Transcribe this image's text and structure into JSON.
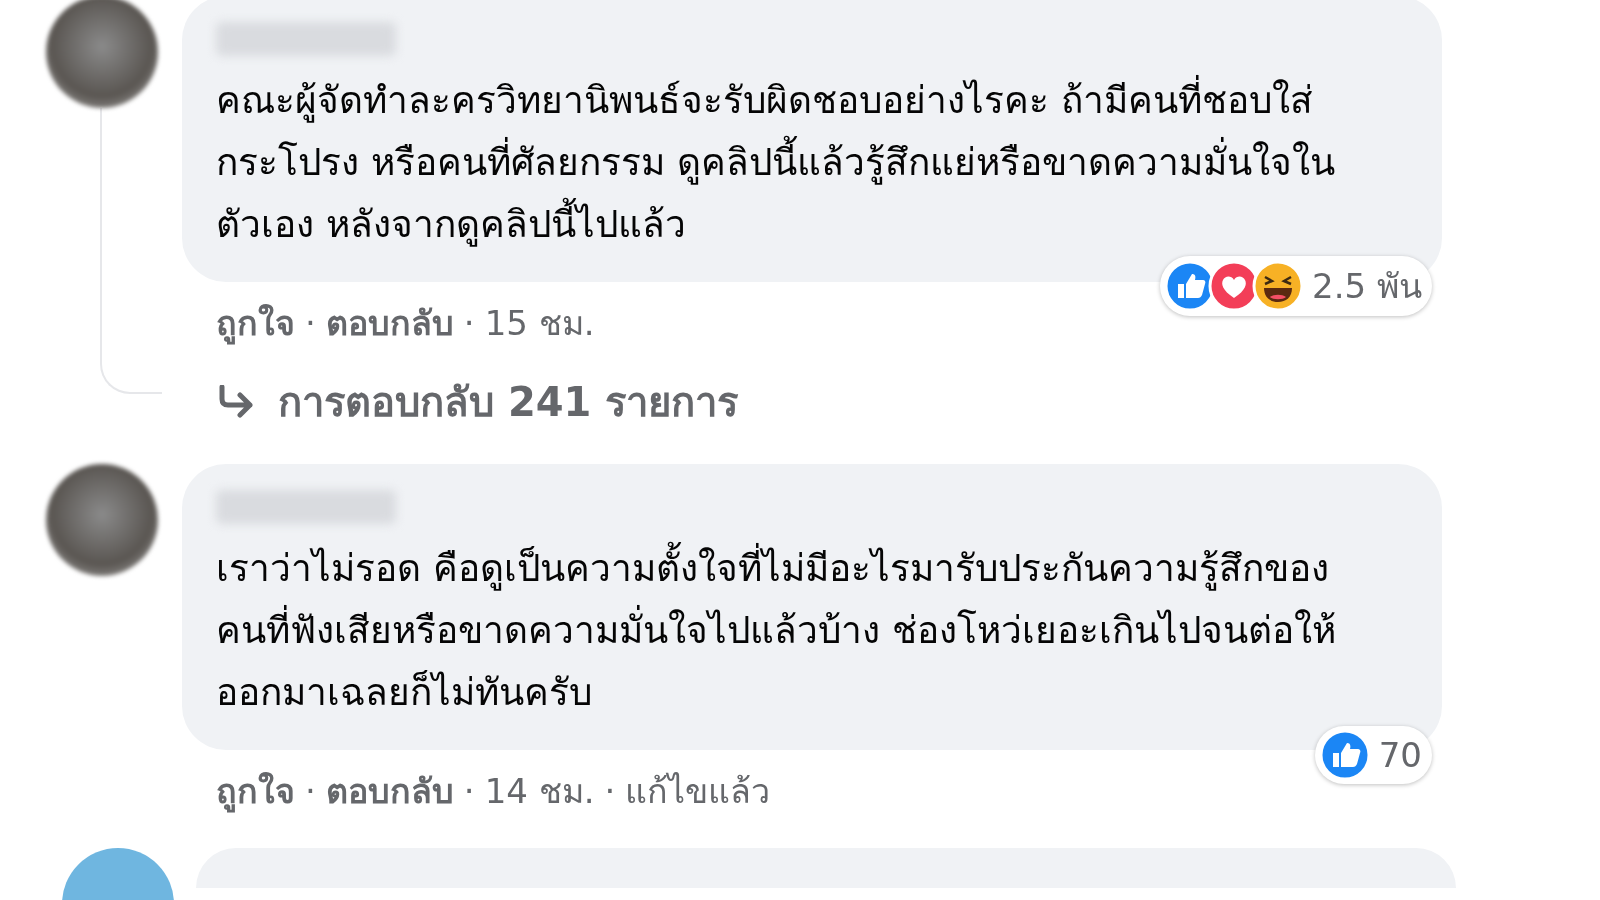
{
  "comments": [
    {
      "text": "คณะผู้จัดทำละครวิทยานิพนธ์จะรับผิดชอบอย่างไรคะ ถ้ามีคนที่ชอบใส่กระโปรง หรือคนที่ศัลยกรรม ดูคลิปนี้แล้วรู้สึกแย่หรือขาดความมั่นใจในตัวเอง หลังจากดูคลิปนี้ไปแล้ว",
      "reactions": {
        "icons": [
          {
            "kind": "like"
          },
          {
            "kind": "love"
          },
          {
            "kind": "haha"
          }
        ],
        "count": "2.5 พัน"
      },
      "meta": [
        {
          "kind": "link",
          "text": "ถูกใจ"
        },
        {
          "kind": "link",
          "text": "ตอบกลับ"
        },
        {
          "kind": "time",
          "text": "15 ชม."
        }
      ],
      "replies": "การตอบกลับ 241 รายการ"
    },
    {
      "text": "เราว่าไม่รอด คือดูเป็นความตั้งใจที่ไม่มีอะไรมารับประกันความรู้สึกของคนที่ฟังเสียหรือขาดความมั่นใจไปแล้วบ้าง ช่องโหว่เยอะเกินไปจนต่อให้ออกมาเฉลยก็ไม่ทันครับ",
      "reactions": {
        "icons": [
          {
            "kind": "like"
          }
        ],
        "count": "70"
      },
      "meta": [
        {
          "kind": "link",
          "text": "ถูกใจ"
        },
        {
          "kind": "link",
          "text": "ตอบกลับ"
        },
        {
          "kind": "time",
          "text": "14 ชม."
        },
        {
          "kind": "note",
          "text": "แก้ไขแล้ว"
        }
      ]
    }
  ],
  "meta_separator": "·",
  "next_comment_peek": true
}
